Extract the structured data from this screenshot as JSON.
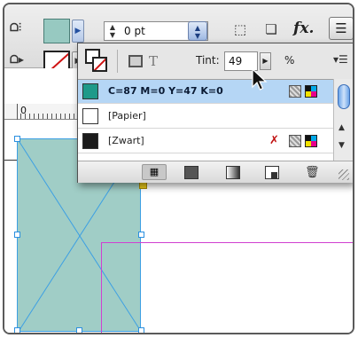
{
  "toolbar": {
    "stroke_weight": "0 pt",
    "fx_label": "fx."
  },
  "swatch_panel": {
    "tint_label": "Tint:",
    "tint_value": "49",
    "tint_unit": "%",
    "swatches": [
      {
        "name": "C=87 M=0 Y=47 K=0",
        "color": "#1f9a8a",
        "selected": true
      },
      {
        "name": "[Papier]",
        "color": "#ffffff",
        "selected": false
      },
      {
        "name": "[Zwart]",
        "color": "#1b1b1b",
        "selected": false
      }
    ]
  },
  "ruler": {
    "zero_label": "0"
  },
  "colors": {
    "fill": "#97c9c1",
    "frame_fill": "#a0cdc6",
    "selection": "#3c9fe3",
    "margin_guide": "#d040d0",
    "list_selection": "#b5d6f5"
  }
}
